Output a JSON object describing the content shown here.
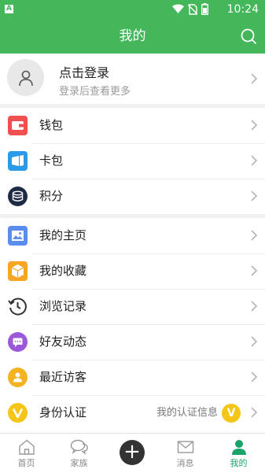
{
  "status_bar": {
    "time": "10:24",
    "app_icon_letter": "A"
  },
  "header": {
    "title": "我的"
  },
  "profile": {
    "title": "点击登录",
    "subtitle": "登录后查看更多"
  },
  "menu_groups": [
    [
      {
        "label": "钱包",
        "icon": "wallet-icon",
        "color": "#f0504f"
      },
      {
        "label": "卡包",
        "icon": "card-pack-icon",
        "color": "#2d9ae8"
      },
      {
        "label": "积分",
        "icon": "points-icon",
        "color": "#1f2a44"
      }
    ],
    [
      {
        "label": "我的主页",
        "icon": "homepage-icon",
        "color": "#5b8def"
      },
      {
        "label": "我的收藏",
        "icon": "favorites-icon",
        "color": "#f6a623"
      },
      {
        "label": "浏览记录",
        "icon": "history-icon",
        "color": "#333333"
      },
      {
        "label": "好友动态",
        "icon": "friend-feed-icon",
        "color": "#9b59d9"
      },
      {
        "label": "最近访客",
        "icon": "visitors-icon",
        "color": "#f5b321"
      },
      {
        "label": "身份认证",
        "icon": "verification-icon",
        "color": "#f5c518",
        "extra": "我的认证信息",
        "badge": "V"
      }
    ]
  ],
  "tabs": [
    {
      "label": "首页",
      "icon": "home-icon"
    },
    {
      "label": "家族",
      "icon": "chat-bubbles-icon"
    },
    {
      "label": "",
      "icon": "plus-icon"
    },
    {
      "label": "消息",
      "icon": "mail-icon"
    },
    {
      "label": "我的",
      "icon": "person-icon",
      "active": true
    }
  ],
  "colors": {
    "brand": "#43b75a",
    "active_tab": "#1aa36a"
  }
}
